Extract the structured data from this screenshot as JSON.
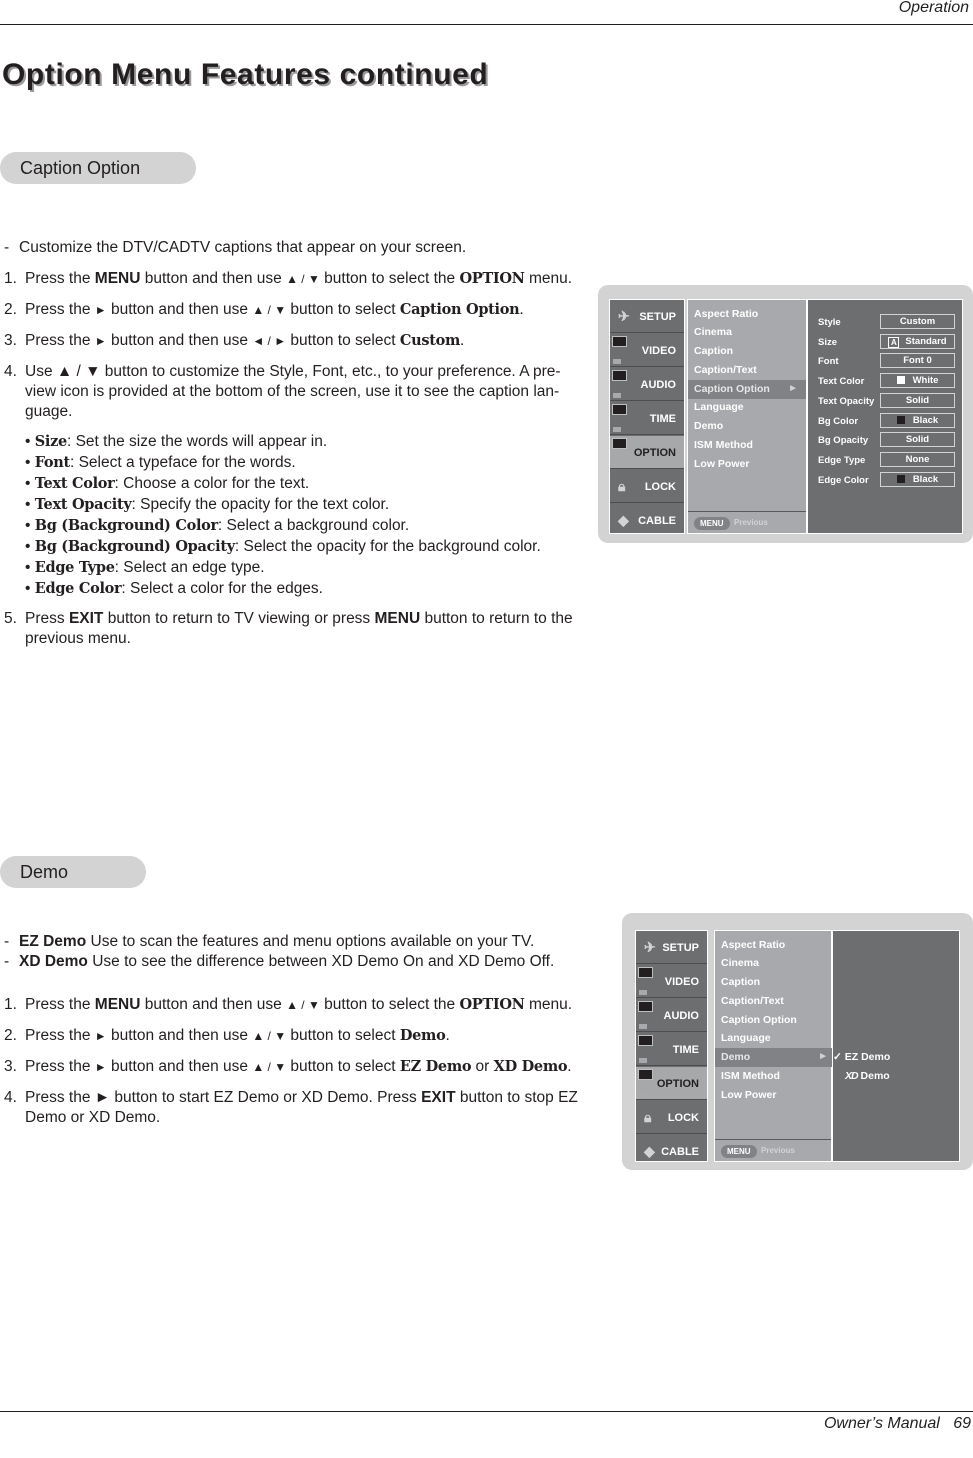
{
  "header": {
    "section": "Operation"
  },
  "page_title": "Option Menu Features continued",
  "caption_option": {
    "pill_label": "Caption Option",
    "intro": "Customize the DTV/CADTV captions that appear on your screen.",
    "steps": [
      {
        "num": "1.",
        "parts": [
          "Press the ",
          "MENU",
          " button and then use ",
          "▲ / ▼",
          "  button to select the ",
          "OPTION",
          " menu."
        ]
      },
      {
        "num": "2.",
        "parts": [
          "Press the ",
          "►",
          " button and then use ",
          "▲ / ▼",
          " button to select ",
          "Caption Option",
          "."
        ]
      },
      {
        "num": "3.",
        "parts": [
          "Press the ",
          "►",
          " button and then use ",
          "◄ / ►",
          " button to select ",
          "Custom",
          "."
        ]
      },
      {
        "num": "4.",
        "text": "Use ▲ / ▼ button to customize the Style, Font, etc., to your preference. A pre-view icon is provided at the bottom of the screen, use it to see the caption lan-guage."
      }
    ],
    "bullets": [
      {
        "term": "Size",
        "desc": ": Set the size the words will appear in."
      },
      {
        "term": "Font",
        "desc": ": Select a typeface for the words."
      },
      {
        "term": "Text Color",
        "desc": ": Choose a color for the text."
      },
      {
        "term": "Text Opacity",
        "desc": ": Specify the opacity for the text color."
      },
      {
        "term": "Bg (Background) Color",
        "desc": ": Select a background color."
      },
      {
        "term": "Bg (Background) Opacity",
        "desc": ": Select the opacity for the background color."
      },
      {
        "term": "Edge Type",
        "desc": ": Select an edge type."
      },
      {
        "term": "Edge Color",
        "desc": ": Select a color for the edges."
      }
    ],
    "step5": {
      "num": "5.",
      "p1": "Press ",
      "b1": "EXIT",
      "p2": " button to return to TV viewing or press ",
      "b2": "MENU",
      "p3": " button to return to the previous menu."
    }
  },
  "osd_caption": {
    "sidebar": [
      "SETUP",
      "VIDEO",
      "AUDIO",
      "TIME",
      "OPTION",
      "LOCK",
      "CABLE"
    ],
    "active_sidebar": "OPTION",
    "menu_items": [
      "Aspect Ratio",
      "Cinema",
      "Caption",
      "Caption/Text",
      "Caption Option",
      "Language",
      "Demo",
      "ISM Method",
      "Low Power"
    ],
    "selected_item": "Caption Option",
    "footer_button": "MENU",
    "footer_label": "Previous",
    "settings": [
      {
        "label": "Style",
        "value": "Custom"
      },
      {
        "label": "Size",
        "value": "Standard",
        "icon": "A"
      },
      {
        "label": "Font",
        "value": "Font  0"
      },
      {
        "label": "Text Color",
        "value": "White",
        "swatch": "#ffffff"
      },
      {
        "label": "Text Opacity",
        "value": "Solid"
      },
      {
        "label": "Bg Color",
        "value": "Black",
        "swatch": "#231f20"
      },
      {
        "label": "Bg Opacity",
        "value": "Solid"
      },
      {
        "label": "Edge Type",
        "value": "None"
      },
      {
        "label": "Edge Color",
        "value": "Black",
        "swatch": "#231f20"
      }
    ]
  },
  "demo": {
    "pill_label": "Demo",
    "defs": [
      {
        "term": "EZ Demo",
        "desc": "  Use to scan the features and menu options available on your TV."
      },
      {
        "term": "XD Demo",
        "desc": "  Use to see the difference between XD Demo On and XD Demo Off."
      }
    ],
    "steps": [
      {
        "num": "1.",
        "parts": [
          "Press the ",
          "MENU",
          " button and then use ",
          "▲ / ▼",
          "  button to select the ",
          "OPTION",
          " menu."
        ]
      },
      {
        "num": "2.",
        "parts": [
          "Press the ",
          "►",
          "  button and then use ",
          "▲ / ▼",
          " button to select ",
          "Demo",
          "."
        ]
      },
      {
        "num": "3.",
        "parts": [
          "Press the ",
          "►",
          "  button and then use ",
          "▲ / ▼",
          " button to select ",
          "EZ Demo",
          " or ",
          "XD Demo",
          "."
        ]
      },
      {
        "num": "4.",
        "p1": "Press the ► button to start EZ Demo or XD Demo. Press ",
        "b1": "EXIT",
        "p2": " button to stop EZ Demo or XD Demo."
      }
    ]
  },
  "osd_demo": {
    "sidebar": [
      "SETUP",
      "VIDEO",
      "AUDIO",
      "TIME",
      "OPTION",
      "LOCK",
      "CABLE"
    ],
    "active_sidebar": "OPTION",
    "menu_items": [
      "Aspect Ratio",
      "Cinema",
      "Caption",
      "Caption/Text",
      "Caption Option",
      "Language",
      "Demo",
      "ISM Method",
      "Low Power"
    ],
    "selected_item": "Demo",
    "footer_button": "MENU",
    "footer_label": "Previous",
    "submenu": [
      {
        "label": "EZ Demo",
        "checked": true,
        "prefix": "✓"
      },
      {
        "label": "Demo",
        "checked": false,
        "prefix": "XD"
      }
    ]
  },
  "footer": {
    "manual": "Owner’s Manual",
    "page": "69"
  }
}
